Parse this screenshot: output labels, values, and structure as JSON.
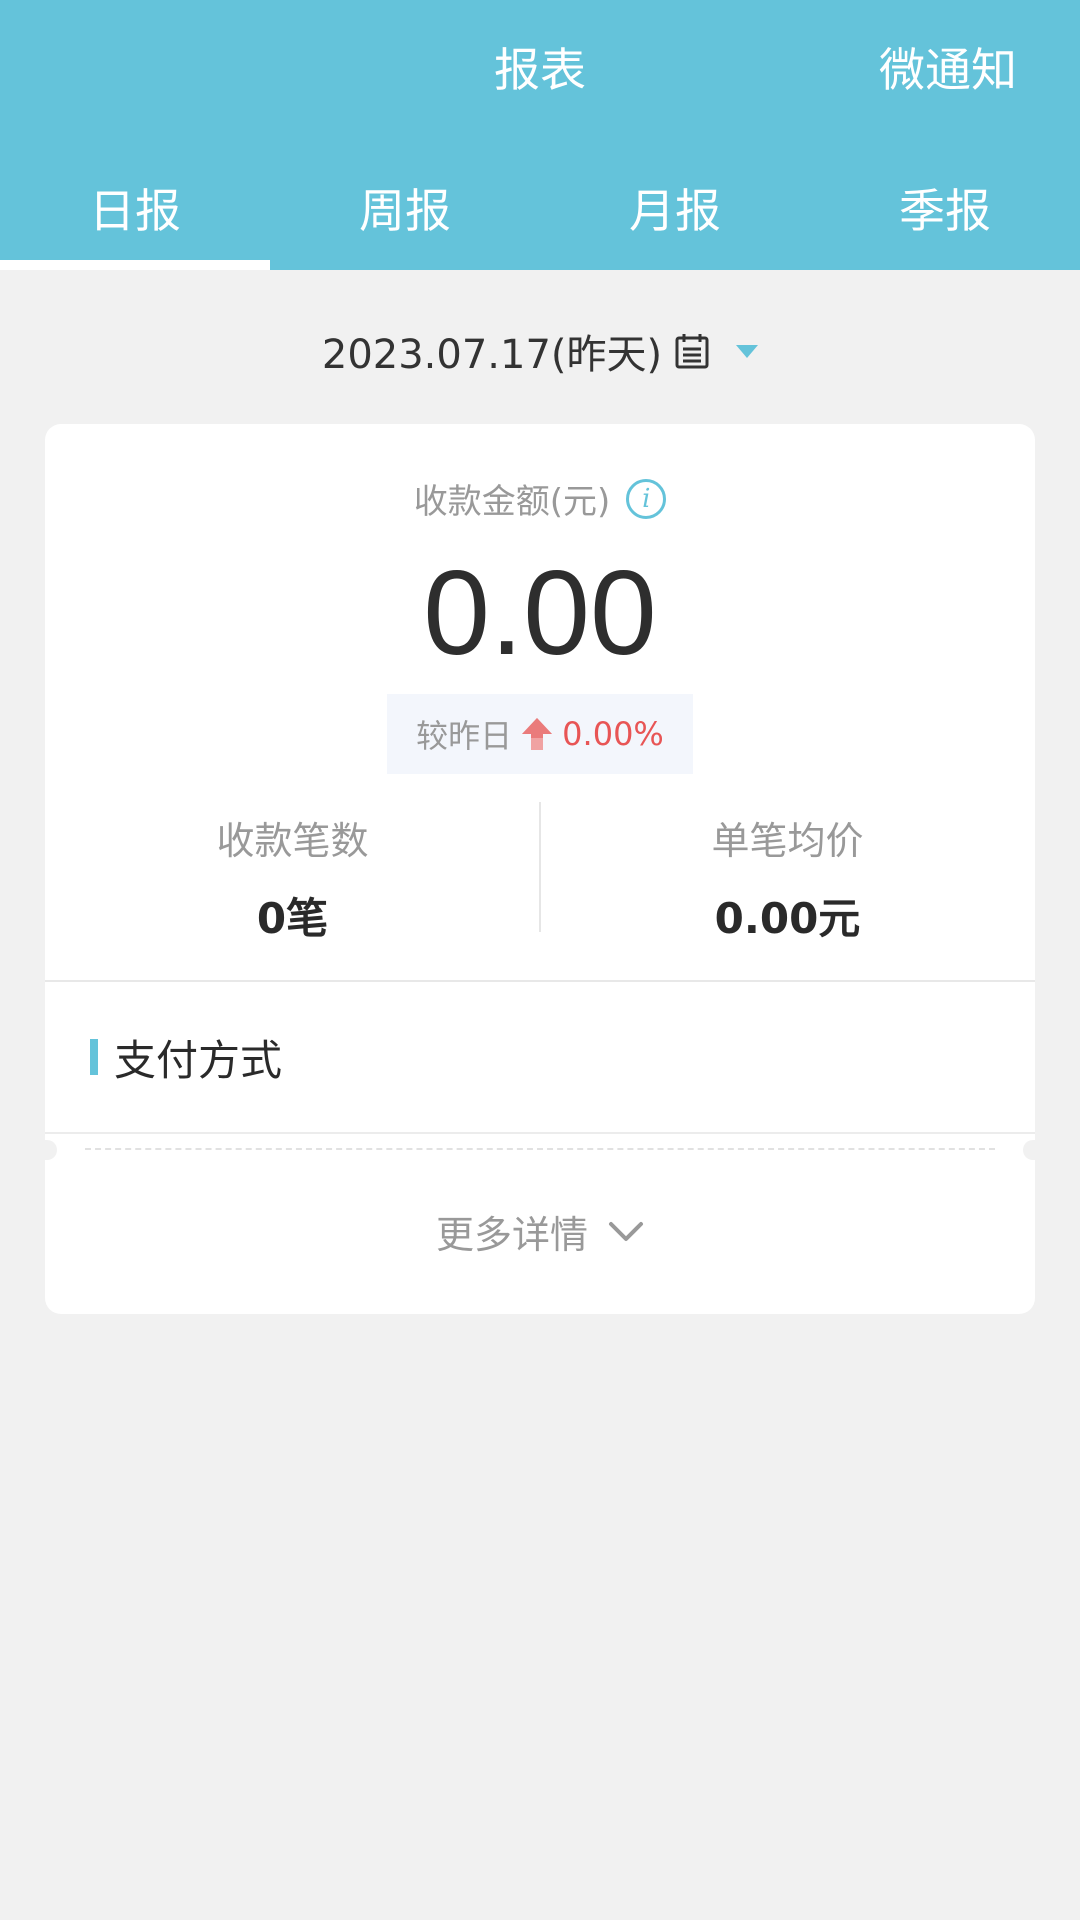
{
  "header": {
    "title": "报表",
    "notify_label": "微通知",
    "tabs": [
      {
        "label": "日报",
        "active": true
      },
      {
        "label": "周报",
        "active": false
      },
      {
        "label": "月报",
        "active": false
      },
      {
        "label": "季报",
        "active": false
      }
    ]
  },
  "date_selector": {
    "value": "2023.07.17(昨天)",
    "calendar_icon": "calendar-icon",
    "caret_icon": "caret-down-icon"
  },
  "summary": {
    "amount_label": "收款金额(元)",
    "info_icon_text": "i",
    "amount_value": "0.00",
    "compare_label": "较昨日",
    "compare_value": "0.00%",
    "compare_direction": "up"
  },
  "stats": [
    {
      "label": "收款笔数",
      "value": "0笔"
    },
    {
      "label": "单笔均价",
      "value": "0.00元"
    }
  ],
  "payment_section": {
    "title": "支付方式"
  },
  "more_details": {
    "label": "更多详情"
  },
  "colors": {
    "accent": "#64c3da",
    "background": "#f1f1f1",
    "card": "#ffffff",
    "up": "#e85555"
  }
}
